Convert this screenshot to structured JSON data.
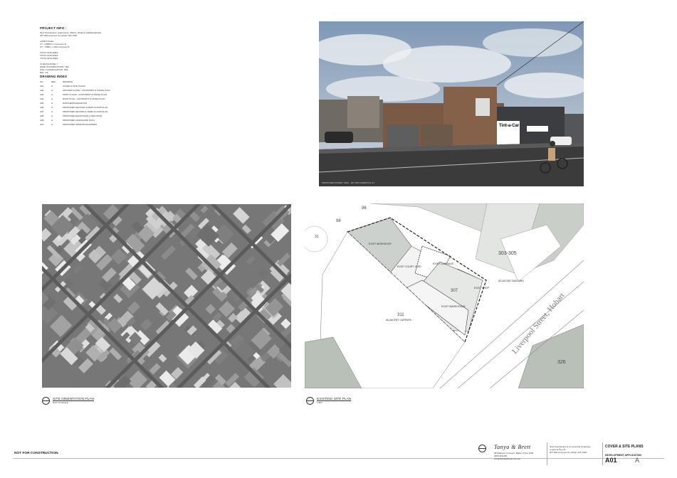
{
  "project_info": {
    "heading": "PROJECT INFO :",
    "lines": [
      "New Townhouses, Apartments, Offices, Retail & Café/Restaurant",
      "307-309 Liverpool St, Hobart TAS 7000",
      "",
      "LAND TITLES:",
      "CT : 235600 / 1 Liverpool St",
      "CT : 74553 / 1 309 Liverpool St",
      "",
      "TOTAL SITE AREA",
      "TOTAL SITE AREA",
      "TOTAL SITE AREA",
      "",
      "CLIMATE ZONE: 7",
      "WIND CLASSIFICATION: TBA",
      "SOIL CLASSIFICATION: TBA",
      "BAL: NA"
    ]
  },
  "drawing_index": {
    "heading": "DRAWING INDEX",
    "columns": [
      "NO.",
      "REV.",
      "DRAWING"
    ],
    "rows": [
      [
        "A01",
        "A",
        "COVER & SITE PLANS"
      ],
      [
        "A02",
        "A",
        "GROUND FLOOR - FOOTPRINT & FINISH PLAN"
      ],
      [
        "A03",
        "A",
        "FIRST FLOOR - FOOTPRINT & FINISH PLAN"
      ],
      [
        "A04",
        "A",
        "ROOF PLAN - FOOTPRINT & FINISH PLAN"
      ],
      [
        "A05",
        "A",
        "NORTHERN ELEVATION"
      ],
      [
        "A06",
        "A",
        "PROPOSED GROUND & FIRST FLOOR PLAN"
      ],
      [
        "A07",
        "A",
        "PROPOSED SECOND & THIRD FLOOR PLAN"
      ],
      [
        "A08",
        "A",
        "PROPOSED ELEVATIONS & SECTIONS"
      ],
      [
        "A09",
        "A",
        "PROPOSED LANDSCAPE PLAN"
      ],
      [
        "A10",
        "A",
        "PROPOSED SHADOW DIAGRAMS"
      ]
    ]
  },
  "photo": {
    "caption": "PROPOSED STREET VIEW - 307-309 LIVERPOOL ST",
    "shop_sign": "Tint-a-Car"
  },
  "site_orientation": {
    "title": "SITE ORIENTATION PLAN",
    "scale": "NOT TO SCALE"
  },
  "existing_site": {
    "title": "EXISTING SITE PLAN",
    "scale": "1:500",
    "street_label": "Liverpool Street, Hobart",
    "labels": {
      "lot_96": "96",
      "lot_98": "98",
      "lot_303_305": "303-305",
      "lot_307": "307",
      "lot_311": "311",
      "lot_326": "326",
      "lot_31": "31",
      "workshop": "EXIST WORKSHOP",
      "courtyard": "EXIST COURT YARD",
      "carriage": "EXIST CARRIAGE",
      "shop": "EXIST SHOP",
      "warehouse": "EXIST WAREHOUSE",
      "adj_building": "ADJACENT BUILDING",
      "adj_car": "ADJACENT CARPARK"
    }
  },
  "footer": {
    "not_for_construction": "NOT FOR CONSTRUCTION",
    "firm_signature": "Tanya & Brett",
    "firm_lines": [
      "38 Waterloo Crescent, Battery Point 7004",
      "0409 000 000",
      "info@tanyaandbrett.com.au"
    ],
    "project_lines": [
      "New Townhouses & Commercial Tenancies",
      "Liverpool Pty Ltd",
      "307-309 Liverpool St, Hobart TAS 7000"
    ],
    "stage": "DEVELOPMENT APPLICATION",
    "sheet_title": "COVER & SITE PLANS",
    "sheet_no": "A01",
    "rev": "A"
  }
}
